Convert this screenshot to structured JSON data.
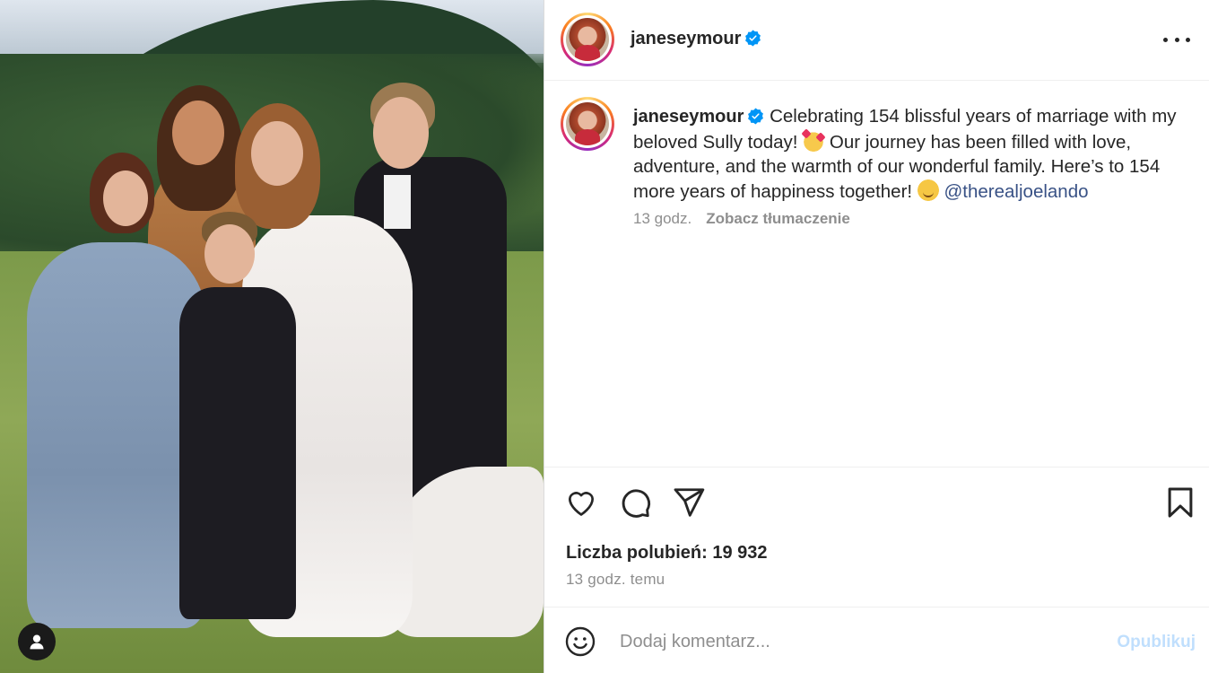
{
  "post_image": {
    "icon": "person-icon"
  },
  "header": {
    "username": "janeseymour",
    "verified_icon": "verified-badge-icon",
    "more_icon": "more-options-icon"
  },
  "caption": {
    "username": "janeseymour",
    "text_part1": " Celebrating 154 blissful years of marriage with my beloved Sully today! ",
    "emoji1": "smiling-face-with-hearts-emoji",
    "text_part2": " Our journey has been filled with love, adventure, and the warmth of our wonderful family. Here’s to 154 more years of happiness together! ",
    "emoji2": "smiling-face-emoji",
    "mention": "@therealjoelando",
    "time": "13 godz.",
    "translate_label": "Zobacz tłumaczenie"
  },
  "actions": {
    "like_icon": "heart-icon",
    "comment_icon": "comment-icon",
    "share_icon": "send-icon",
    "save_icon": "bookmark-icon",
    "likes_text": "Liczba polubień: 19 932",
    "posted_ago": "13 godz. temu"
  },
  "comment_bar": {
    "emoji_icon": "emoji-icon",
    "placeholder": "Dodaj komentarz...",
    "publish_label": "Opublikuj"
  },
  "colors": {
    "mention": "#385185",
    "muted": "#8e8e8e",
    "publish_disabled": "#c0dffd",
    "verified": "#0095f6"
  }
}
